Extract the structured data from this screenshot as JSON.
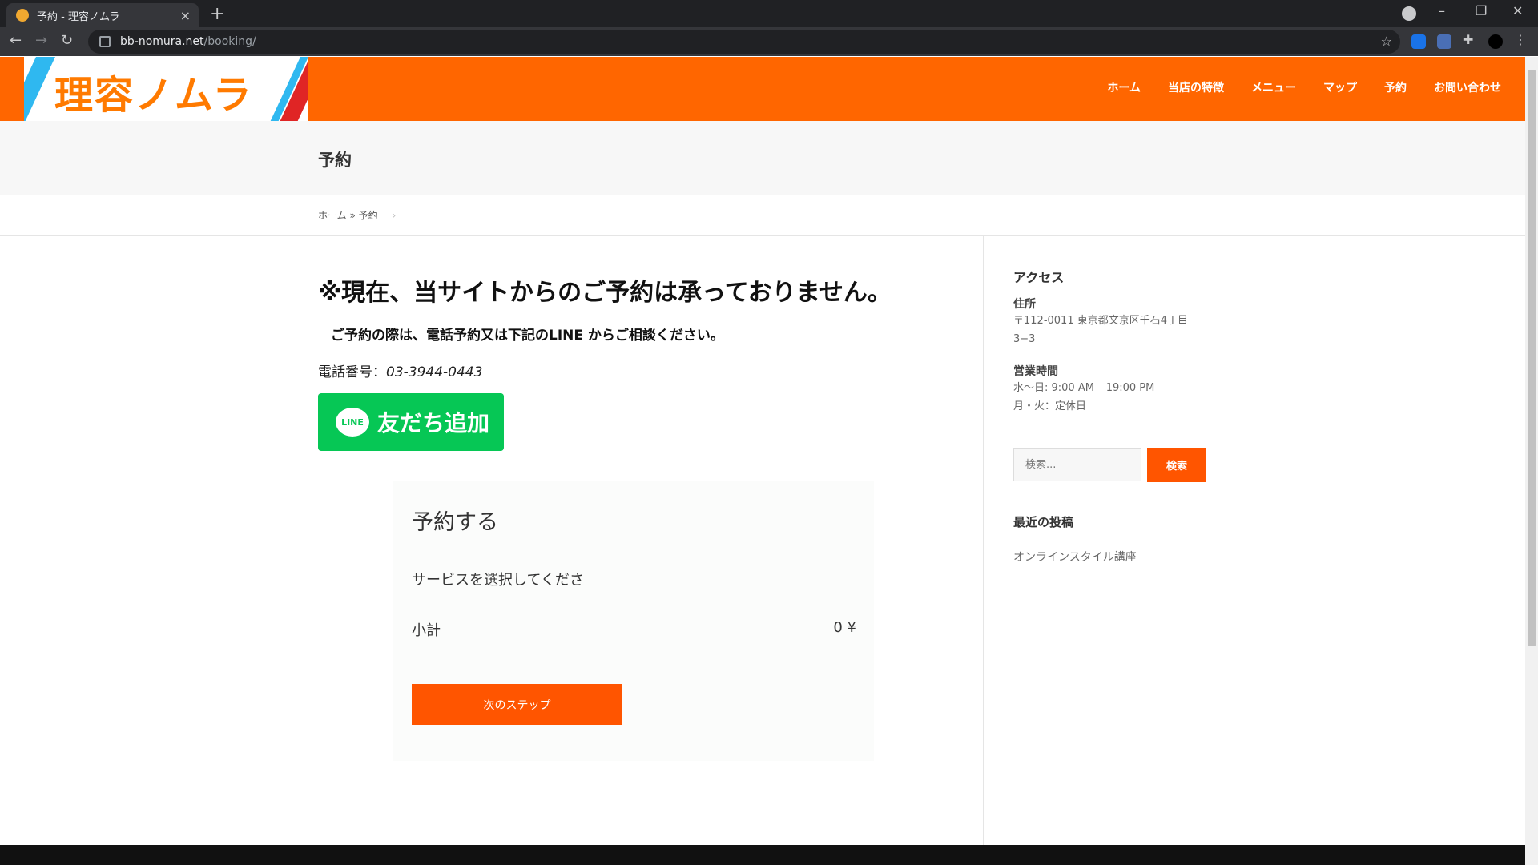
{
  "browser": {
    "tab_title": "予約 - 理容ノムラ",
    "tab_close": "×",
    "new_tab": "+",
    "url_host": "bb-nomura.net",
    "url_path": "/booking/",
    "minimize": "–",
    "restore": "❐",
    "close": "✕",
    "back": "←",
    "forward": "→",
    "reload": "↻",
    "star": "☆"
  },
  "site": {
    "logo_text": "理容ノムラ",
    "nav": [
      "ホーム",
      "当店の特徴",
      "メニュー",
      "マップ",
      "予約",
      "お問い合わせ"
    ],
    "page_title": "予約",
    "breadcrumb": {
      "home": "ホーム",
      "sep": "»",
      "current": "予約"
    }
  },
  "main": {
    "notice": "※現在、当サイトからのご予約は承っておりません。",
    "sub_notice": "ご予約の際は、電話予約又は下記のLINE からご相談ください。",
    "phone_label": "電話番号：",
    "phone_number": "03-3944-0443",
    "line_badge": "LINE",
    "line_button": "友だち追加",
    "booking": {
      "title": "予約する",
      "select_prompt": "サービスを選択してくださ",
      "subtotal_label": "小計",
      "subtotal_value": "0 ¥",
      "next_button": "次のステップ"
    }
  },
  "sidebar": {
    "access_heading": "アクセス",
    "address_label": "住所",
    "address_line1": "〒112-0011 東京都文京区千石4丁目",
    "address_line2": "3−3",
    "hours_label": "営業時間",
    "hours_line1": "水〜日: 9:00 AM – 19:00 PM",
    "hours_line2": "月・火：定休日",
    "search_placeholder": "検索...",
    "search_button": "検索",
    "recent_heading": "最近の投稿",
    "recent_posts": [
      "オンラインスタイル講座"
    ]
  },
  "colors": {
    "brand_orange": "#ff6600",
    "button_orange": "#ff5500",
    "line_green": "#06c755"
  }
}
